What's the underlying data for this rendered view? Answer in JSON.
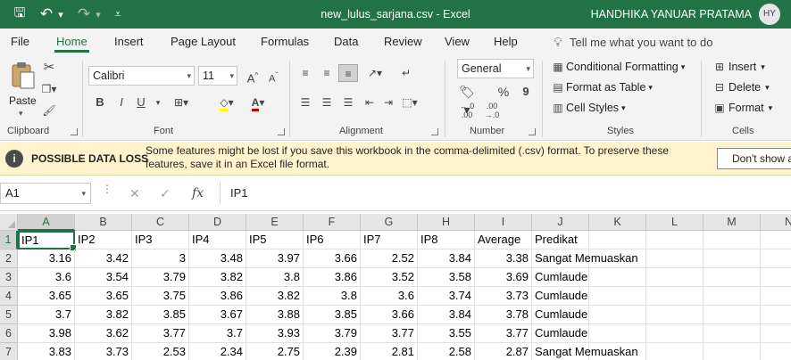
{
  "window": {
    "title": "new_lulus_sarjana.csv  -  Excel",
    "user_name": "HANDHIKA YANUAR PRATAMA",
    "user_initials": "HY",
    "accent_color": "#217346",
    "quick_access": [
      {
        "name": "save-icon",
        "glyph": "🖫"
      },
      {
        "name": "undo-icon",
        "glyph": "↶"
      },
      {
        "name": "undo-dropdown-icon",
        "glyph": "▾"
      },
      {
        "name": "redo-icon",
        "glyph": "↷"
      },
      {
        "name": "redo-dropdown-icon",
        "glyph": "▾"
      },
      {
        "name": "customize-quick-access-icon",
        "glyph": "⩡"
      }
    ]
  },
  "tabs": [
    {
      "label": "File",
      "active": false
    },
    {
      "label": "Home",
      "active": true
    },
    {
      "label": "Insert",
      "active": false
    },
    {
      "label": "Page Layout",
      "active": false
    },
    {
      "label": "Formulas",
      "active": false
    },
    {
      "label": "Data",
      "active": false
    },
    {
      "label": "Review",
      "active": false
    },
    {
      "label": "View",
      "active": false
    },
    {
      "label": "Help",
      "active": false
    }
  ],
  "tell_me": "Tell me what you want to do",
  "ribbon": {
    "clipboard": {
      "label": "Clipboard",
      "paste": "Paste"
    },
    "font": {
      "label": "Font",
      "name": "Calibri",
      "size": "11",
      "bold": "B",
      "italic": "I",
      "underline": "U"
    },
    "alignment": {
      "label": "Alignment"
    },
    "number": {
      "label": "Number",
      "format": "General",
      "percent": "%",
      "comma": "9",
      "increase_decimal": "←.0\n.00",
      "decrease_decimal": ".00\n→.0"
    },
    "styles": {
      "label": "Styles",
      "conditional": "Conditional Formatting",
      "format_table": "Format as Table",
      "cell_styles": "Cell Styles"
    },
    "cells": {
      "label": "Cells",
      "insert": "Insert",
      "delete": "Delete",
      "format": "Format"
    }
  },
  "message_bar": {
    "label": "POSSIBLE DATA LOSS",
    "text": "Some features might be lost if you save this workbook in the comma-delimited (.csv) format. To preserve these features, save it in an Excel file format.",
    "button": "Don't show again"
  },
  "formula_bar": {
    "name_box": "A1",
    "cancel_glyph": "✕",
    "enter_glyph": "✓",
    "fx_glyph": "fx",
    "content": "IP1"
  },
  "sheet": {
    "columns": [
      "A",
      "B",
      "C",
      "D",
      "E",
      "F",
      "G",
      "H",
      "I",
      "J",
      "K",
      "L",
      "M",
      "N"
    ],
    "selected_column": "A",
    "selected_row": 1,
    "rows": [
      {
        "num": "1",
        "cells": [
          "IP1",
          "IP2",
          "IP3",
          "IP4",
          "IP5",
          "IP6",
          "IP7",
          "IP8",
          "Average",
          "Predikat"
        ]
      },
      {
        "num": "2",
        "cells": [
          "3.16",
          "3.42",
          "3",
          "3.48",
          "3.97",
          "3.66",
          "2.52",
          "3.84",
          "3.38",
          "Sangat Memuaskan"
        ]
      },
      {
        "num": "3",
        "cells": [
          "3.6",
          "3.54",
          "3.79",
          "3.82",
          "3.8",
          "3.86",
          "3.52",
          "3.58",
          "3.69",
          "Cumlaude"
        ]
      },
      {
        "num": "4",
        "cells": [
          "3.65",
          "3.65",
          "3.75",
          "3.86",
          "3.82",
          "3.8",
          "3.6",
          "3.74",
          "3.73",
          "Cumlaude"
        ]
      },
      {
        "num": "5",
        "cells": [
          "3.7",
          "3.82",
          "3.85",
          "3.67",
          "3.88",
          "3.85",
          "3.66",
          "3.84",
          "3.78",
          "Cumlaude"
        ]
      },
      {
        "num": "6",
        "cells": [
          "3.98",
          "3.62",
          "3.77",
          "3.7",
          "3.93",
          "3.79",
          "3.77",
          "3.55",
          "3.77",
          "Cumlaude"
        ]
      },
      {
        "num": "7",
        "cells": [
          "3.83",
          "3.73",
          "2.53",
          "2.34",
          "2.75",
          "2.39",
          "2.81",
          "2.58",
          "2.87",
          "Sangat Memuaskan"
        ]
      }
    ]
  }
}
